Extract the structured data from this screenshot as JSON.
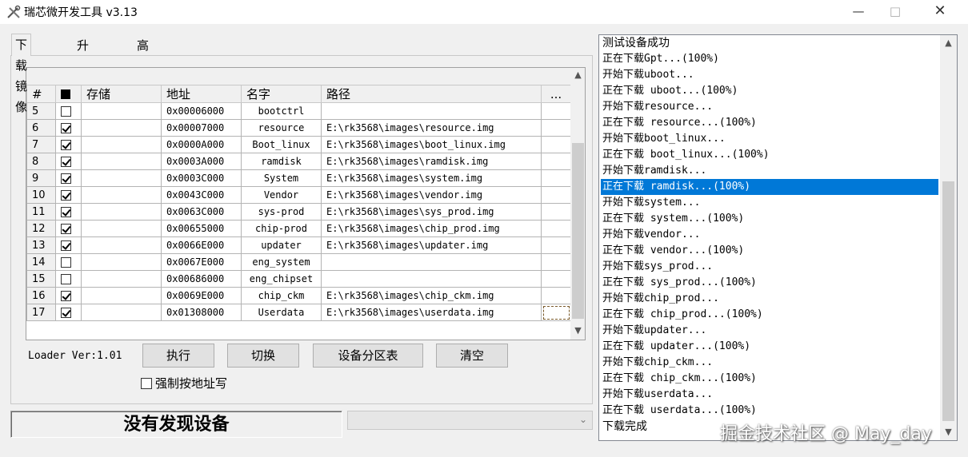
{
  "window": {
    "title": "瑞芯微开发工具 v3.13",
    "min_icon": "minimize-icon",
    "max_icon": "maximize-icon",
    "close_icon": "close-icon"
  },
  "tabs": [
    {
      "label": "下载镜像",
      "active": true
    },
    {
      "label": "升级固件",
      "active": false
    },
    {
      "label": "高级功能",
      "active": false
    }
  ],
  "grid": {
    "columns": [
      "#",
      "",
      "存储",
      "地址",
      "名字",
      "路径",
      "..."
    ],
    "rows": [
      {
        "index": "5",
        "checked": false,
        "storage": "",
        "address": "0x00006000",
        "name": "bootctrl",
        "path": ""
      },
      {
        "index": "6",
        "checked": true,
        "storage": "",
        "address": "0x00007000",
        "name": "resource",
        "path": "E:\\rk3568\\images\\resource.img"
      },
      {
        "index": "7",
        "checked": true,
        "storage": "",
        "address": "0x0000A000",
        "name": "Boot_linux",
        "path": "E:\\rk3568\\images\\boot_linux.img"
      },
      {
        "index": "8",
        "checked": true,
        "storage": "",
        "address": "0x0003A000",
        "name": "ramdisk",
        "path": "E:\\rk3568\\images\\ramdisk.img"
      },
      {
        "index": "9",
        "checked": true,
        "storage": "",
        "address": "0x0003C000",
        "name": "System",
        "path": "E:\\rk3568\\images\\system.img"
      },
      {
        "index": "10",
        "checked": true,
        "storage": "",
        "address": "0x0043C000",
        "name": "Vendor",
        "path": "E:\\rk3568\\images\\vendor.img"
      },
      {
        "index": "11",
        "checked": true,
        "storage": "",
        "address": "0x0063C000",
        "name": "sys-prod",
        "path": "E:\\rk3568\\images\\sys_prod.img"
      },
      {
        "index": "12",
        "checked": true,
        "storage": "",
        "address": "0x00655000",
        "name": "chip-prod",
        "path": "E:\\rk3568\\images\\chip_prod.img"
      },
      {
        "index": "13",
        "checked": true,
        "storage": "",
        "address": "0x0066E000",
        "name": "updater",
        "path": "E:\\rk3568\\images\\updater.img"
      },
      {
        "index": "14",
        "checked": false,
        "storage": "",
        "address": "0x0067E000",
        "name": "eng_system",
        "path": ""
      },
      {
        "index": "15",
        "checked": false,
        "storage": "",
        "address": "0x00686000",
        "name": "eng_chipset",
        "path": ""
      },
      {
        "index": "16",
        "checked": true,
        "storage": "",
        "address": "0x0069E000",
        "name": "chip_ckm",
        "path": "E:\\rk3568\\images\\chip_ckm.img"
      },
      {
        "index": "17",
        "checked": true,
        "storage": "",
        "address": "0x01308000",
        "name": "Userdata",
        "path": "E:\\rk3568\\images\\userdata.img"
      }
    ]
  },
  "loader_version": "Loader Ver:1.01",
  "buttons": {
    "execute": "执行",
    "switch": "切换",
    "partition_table": "设备分区表",
    "clear": "清空"
  },
  "force_address_write": {
    "label": "强制按地址写",
    "checked": false
  },
  "status": "没有发现设备",
  "device_select": {
    "value": ""
  },
  "log": {
    "lines": [
      "测试设备成功",
      "正在下载Gpt...(100%)",
      "开始下载uboot...",
      "正在下载 uboot...(100%)",
      "开始下载resource...",
      "正在下载 resource...(100%)",
      "开始下载boot_linux...",
      "正在下载 boot_linux...(100%)",
      "开始下载ramdisk...",
      "正在下载 ramdisk...(100%)",
      "开始下载system...",
      "正在下载 system...(100%)",
      "开始下载vendor...",
      "正在下载 vendor...(100%)",
      "开始下载sys_prod...",
      "正在下载 sys_prod...(100%)",
      "开始下载chip_prod...",
      "正在下载 chip_prod...(100%)",
      "开始下载updater...",
      "正在下载 updater...(100%)",
      "开始下载chip_ckm...",
      "正在下载 chip_ckm...(100%)",
      "开始下载userdata...",
      "正在下载 userdata...(100%)",
      "下载完成"
    ],
    "selected_index": 9
  },
  "watermark": "掘金技术社区 @ May_day"
}
